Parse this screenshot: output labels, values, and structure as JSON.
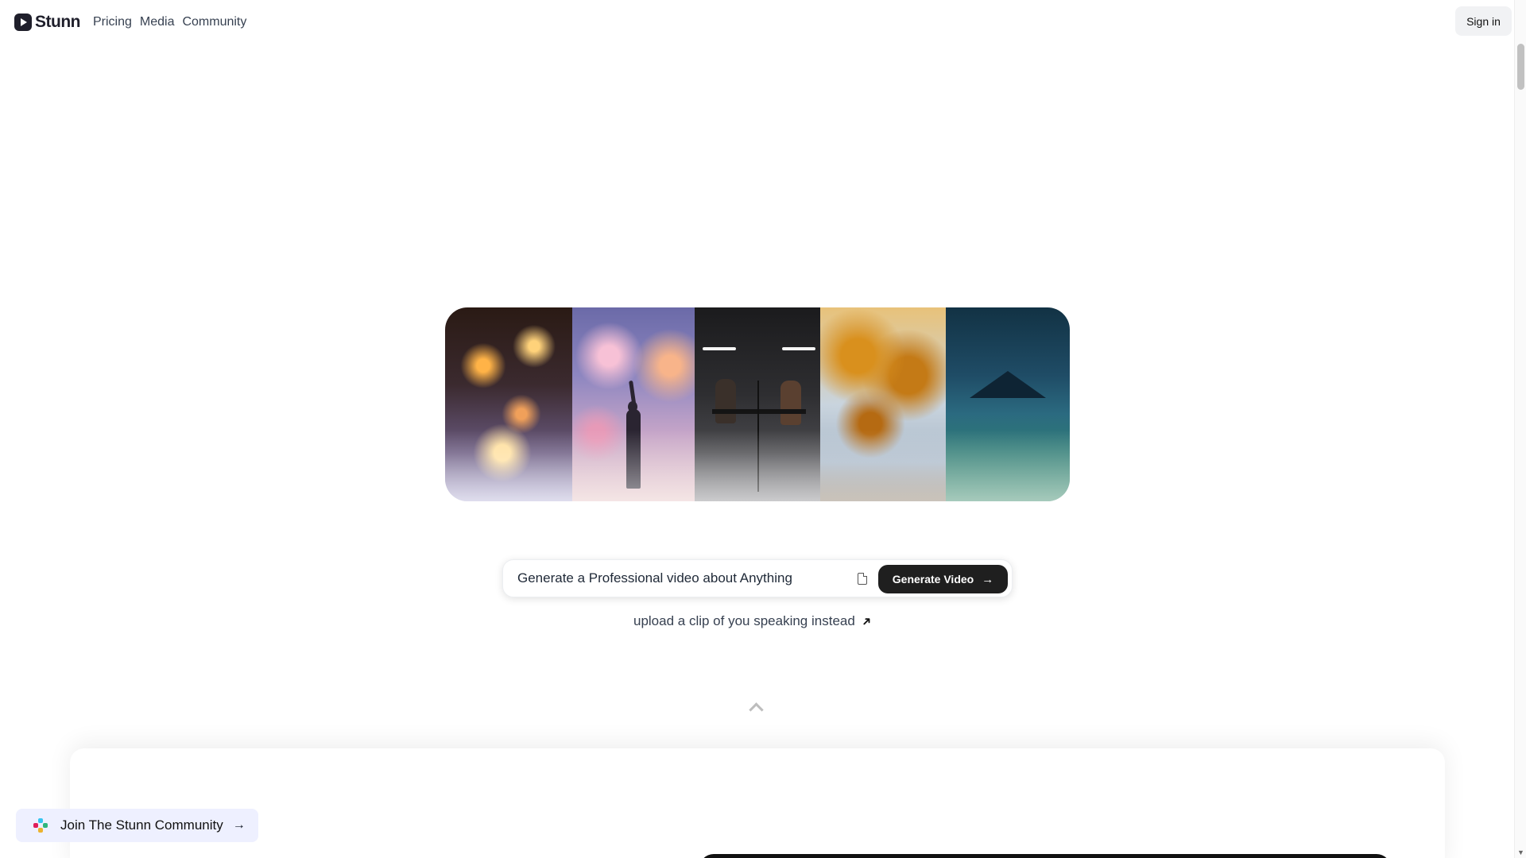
{
  "header": {
    "brand": "Stunn",
    "nav": [
      "Pricing",
      "Media",
      "Community"
    ],
    "signin_label": "Sign in"
  },
  "prompt": {
    "placeholder": "Generate a Professional video about Anything",
    "generate_label": "Generate Video"
  },
  "upload_link_label": "upload a clip of you speaking instead",
  "community_label": "Join The Stunn Community",
  "colors": {
    "primary_dark": "#1f1f1f",
    "community_bg": "#eef0ff"
  }
}
